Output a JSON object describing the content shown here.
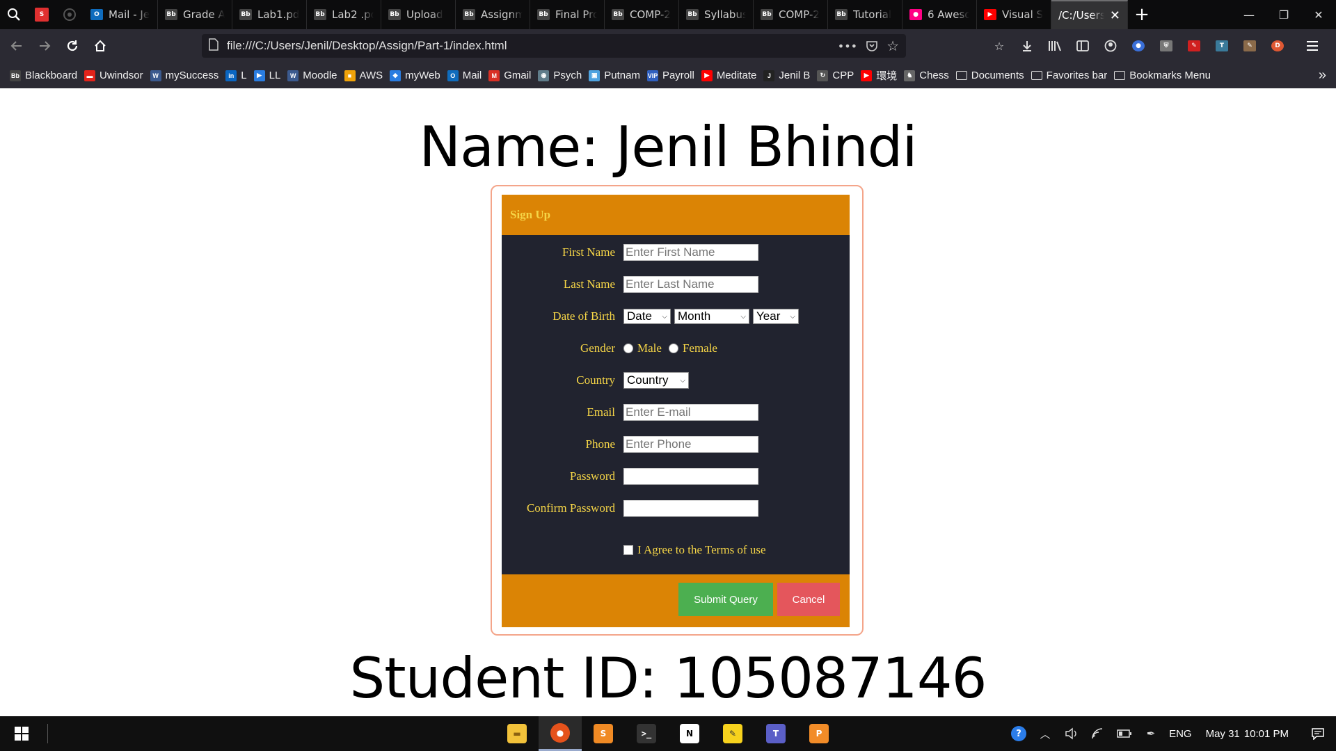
{
  "browser": {
    "tabs": [
      {
        "label": "Mail - Je",
        "icon": "outlook-icon",
        "color": "#0f6cbd"
      },
      {
        "label": "Grade A",
        "icon": "blackboard-icon",
        "color": "#444"
      },
      {
        "label": "Lab1.pd",
        "icon": "blackboard-icon",
        "color": "#444"
      },
      {
        "label": "Lab2 .pd",
        "icon": "blackboard-icon",
        "color": "#444"
      },
      {
        "label": "Upload",
        "icon": "blackboard-icon",
        "color": "#444"
      },
      {
        "label": "Assignm",
        "icon": "blackboard-icon",
        "color": "#444"
      },
      {
        "label": "Final Pro",
        "icon": "blackboard-icon",
        "color": "#444"
      },
      {
        "label": "COMP-2",
        "icon": "blackboard-icon",
        "color": "#444"
      },
      {
        "label": "Syllabus",
        "icon": "blackboard-icon",
        "color": "#444"
      },
      {
        "label": "COMP-2",
        "icon": "blackboard-icon",
        "color": "#444"
      },
      {
        "label": "Tutorial",
        "icon": "blackboard-icon",
        "color": "#444"
      },
      {
        "label": "6 Aweso",
        "icon": "flickr-icon",
        "color": "#ff0084"
      },
      {
        "label": "Visual S",
        "icon": "youtube-icon",
        "color": "#ff0000"
      }
    ],
    "active_tab": {
      "label": "/C:/Users"
    },
    "url": "file:///C:/Users/Jenil/Desktop/Assign/Part-1/index.html",
    "bookmarks": [
      {
        "label": "Blackboard",
        "icon": "blackboard-icon",
        "color": "#444"
      },
      {
        "label": "Uwindsor",
        "icon": "uwindsor-icon",
        "color": "#e3231b"
      },
      {
        "label": "mySuccess",
        "icon": "w-icon",
        "color": "#3b5a8f"
      },
      {
        "label": "L",
        "icon": "linkedin-icon",
        "color": "#0a66c2"
      },
      {
        "label": "LL",
        "icon": "play-icon",
        "color": "#2a7de1"
      },
      {
        "label": "Moodle",
        "icon": "w-icon",
        "color": "#3b5a8f"
      },
      {
        "label": "AWS",
        "icon": "aws-icon",
        "color": "#f0a30a"
      },
      {
        "label": "myWeb",
        "icon": "vscode-icon",
        "color": "#2a7de1"
      },
      {
        "label": "Mail",
        "icon": "outlook-icon",
        "color": "#0f6cbd"
      },
      {
        "label": "Gmail",
        "icon": "gmail-icon",
        "color": "#d93025"
      },
      {
        "label": "Psych",
        "icon": "psych-icon",
        "color": "#607d8b"
      },
      {
        "label": "Putnam",
        "icon": "cube-icon",
        "color": "#4fa3e0"
      },
      {
        "label": "Payroll",
        "icon": "vip-icon",
        "color": "#3060c0"
      },
      {
        "label": "Meditate",
        "icon": "youtube-icon",
        "color": "#ff0000"
      },
      {
        "label": "Jenil B",
        "icon": "j-icon",
        "color": "#222"
      },
      {
        "label": "CPP",
        "icon": "cpp-icon",
        "color": "#555"
      },
      {
        "label": "環境",
        "icon": "youtube-icon",
        "color": "#ff0000"
      },
      {
        "label": "Chess",
        "icon": "chess-icon",
        "color": "#666"
      },
      {
        "label": "Documents",
        "icon": "folder-icon",
        "color": "#888"
      },
      {
        "label": "Favorites bar",
        "icon": "folder-icon",
        "color": "#888"
      },
      {
        "label": "Bookmarks Menu",
        "icon": "folder-icon",
        "color": "#888"
      }
    ]
  },
  "page": {
    "title": "Name: Jenil Bhindi",
    "student_id": "Student ID: 105087146",
    "form": {
      "header": "Sign Up",
      "first_name_label": "First Name",
      "first_name_placeholder": "Enter First Name",
      "last_name_label": "Last Name",
      "last_name_placeholder": "Enter Last Name",
      "dob_label": "Date of Birth",
      "dob_date": "Date",
      "dob_month": "Month",
      "dob_year": "Year",
      "gender_label": "Gender",
      "gender_male": "Male",
      "gender_female": "Female",
      "country_label": "Country",
      "country_value": "Country",
      "email_label": "Email",
      "email_placeholder": "Enter E-mail",
      "phone_label": "Phone",
      "phone_placeholder": "Enter Phone",
      "password_label": "Password",
      "confirm_password_label": "Confirm Password",
      "terms_label": "I Agree to the Terms of use",
      "submit_label": "Submit Query",
      "cancel_label": "Cancel"
    },
    "colors": {
      "header_bg": "#db8405",
      "header_text": "#f5d547",
      "body_bg": "#21232f",
      "label_text": "#f5d547",
      "submit_bg": "#4caf50",
      "cancel_bg": "#e4565c",
      "outer_border": "#f4a58a"
    }
  },
  "taskbar": {
    "language": "ENG",
    "date": "May 31",
    "time": "10:01 PM"
  }
}
